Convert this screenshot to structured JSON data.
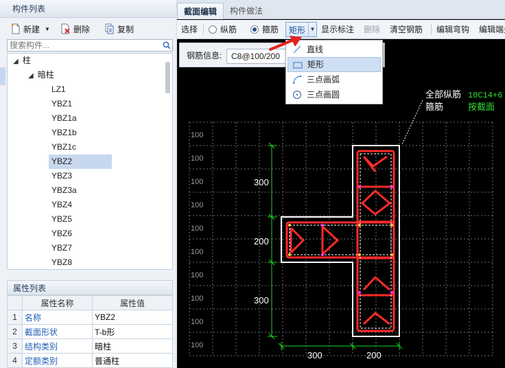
{
  "left": {
    "component_list": {
      "title": "构件列表",
      "toolbar": {
        "new_label": "新建",
        "delete_label": "删除",
        "copy_label": "复制"
      },
      "search_placeholder": "搜索构件...",
      "tree": {
        "root": "柱",
        "group": "暗柱",
        "items": [
          "LZ1",
          "YBZ1",
          "YBZ1a",
          "YBZ1b",
          "YBZ1c",
          "YBZ2",
          "YBZ3",
          "YBZ3a",
          "YBZ4",
          "YBZ5",
          "YBZ6",
          "YBZ7",
          "YBZ8"
        ],
        "selected": "YBZ2"
      }
    },
    "attributes": {
      "title": "属性列表",
      "col_name": "属性名称",
      "col_value": "属性值",
      "rows": [
        {
          "idx": "1",
          "name": "名称",
          "value": "YBZ2"
        },
        {
          "idx": "2",
          "name": "截面形状",
          "value": "T-b形"
        },
        {
          "idx": "3",
          "name": "结构类别",
          "value": "暗柱"
        },
        {
          "idx": "4",
          "name": "定额类别",
          "value": "普通柱"
        }
      ]
    }
  },
  "right": {
    "tabs": [
      {
        "label": "截面编辑",
        "active": true
      },
      {
        "label": "构件做法",
        "active": false
      }
    ],
    "toolbar": {
      "select_label": "选择",
      "longitudinal_label": "纵筋",
      "stirrup_label": "箍筋",
      "shape_label": "矩形",
      "show_dims_label": "显示标注",
      "delete_label": "删除",
      "clear_label": "清空钢筋",
      "edit_hook_label": "编辑弯钩",
      "edit_end_label": "编辑端头"
    },
    "rebar_info": {
      "label": "钢筋信息:",
      "value": "C8@100/200"
    },
    "shape_menu": {
      "items": [
        {
          "label": "直线",
          "icon": "line-icon"
        },
        {
          "label": "矩形",
          "icon": "rectangle-icon"
        },
        {
          "label": "三点画弧",
          "icon": "three-point-arc-icon"
        },
        {
          "label": "三点画圆",
          "icon": "three-point-circle-icon"
        }
      ],
      "highlighted": "矩形"
    },
    "canvas": {
      "annotation_line1": "全部纵筋",
      "annotation_line2": "箍筋",
      "annotation_value1": "10C14+6",
      "annotation_value2": "按截面",
      "grid_label": "100",
      "dim_vertical": [
        "300",
        "200",
        "300"
      ],
      "dim_horizontal": [
        "300",
        "200"
      ],
      "colors": {
        "outline": "#ffffff",
        "stirrup": "#ff2a2a",
        "dimension": "#1fd61f",
        "grid": "#7a7a7a",
        "annotation_value": "#33dd33"
      }
    }
  }
}
